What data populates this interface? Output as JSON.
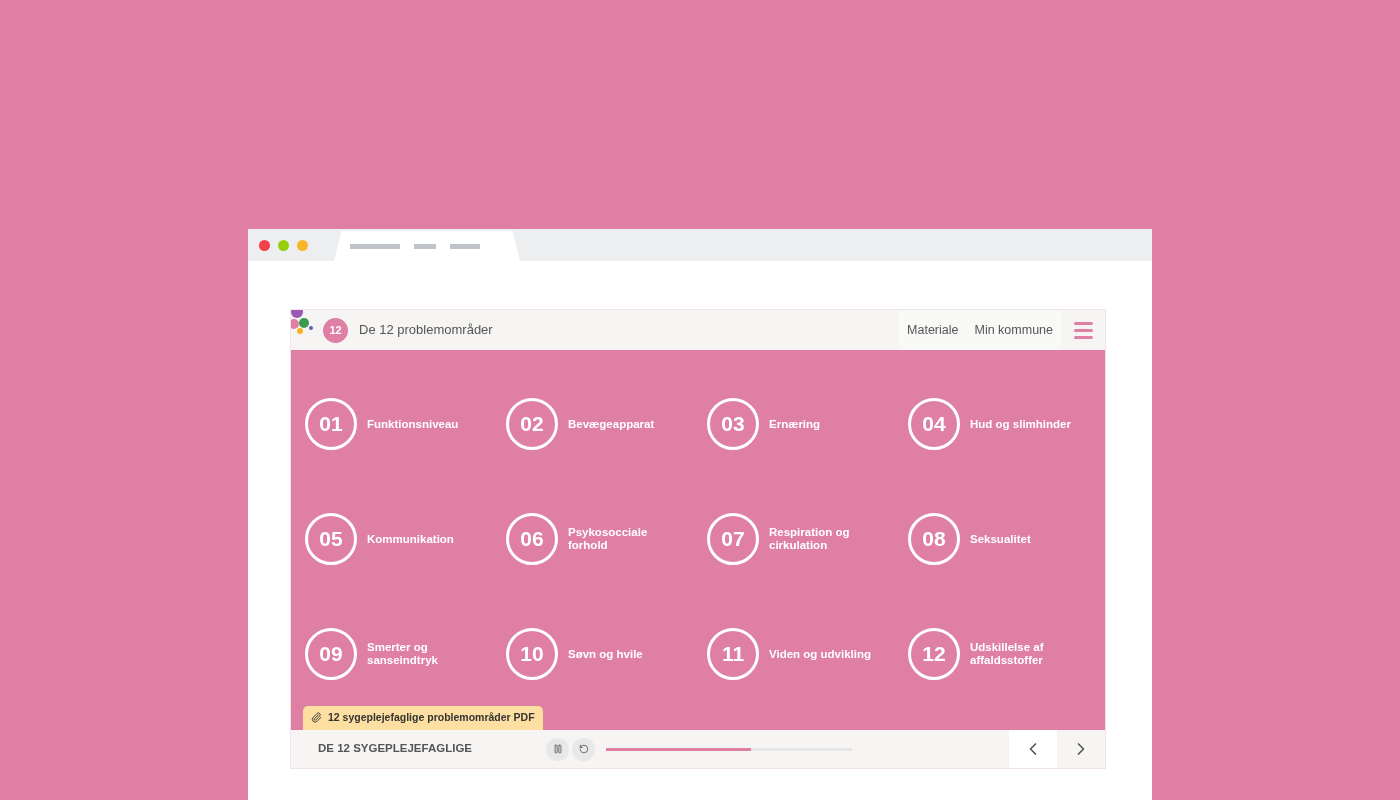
{
  "header": {
    "badge": "12",
    "title": "De 12 problemområder",
    "nav": [
      "Materiale",
      "Min kommune"
    ]
  },
  "topics": [
    {
      "number": "01",
      "label": "Funktionsniveau"
    },
    {
      "number": "02",
      "label": "Bevægeapparat"
    },
    {
      "number": "03",
      "label": "Ernæring"
    },
    {
      "number": "04",
      "label": "Hud og slimhinder"
    },
    {
      "number": "05",
      "label": "Kommunikation"
    },
    {
      "number": "06",
      "label": "Psykosocciale forhold"
    },
    {
      "number": "07",
      "label": "Respiration og cirkulation"
    },
    {
      "number": "08",
      "label": "Seksualitet"
    },
    {
      "number": "09",
      "label": "Smerter og sanseindtryk"
    },
    {
      "number": "10",
      "label": "Søvn og hvile"
    },
    {
      "number": "11",
      "label": "Viden og udvikling"
    },
    {
      "number": "12",
      "label": "Udskillelse af affaldsstoffer"
    }
  ],
  "attachment": {
    "label": "12 sygeplejefaglige problemområder PDF"
  },
  "player": {
    "title": "DE 12 SYGEPLEJEFAGLIGE",
    "progress": {
      "level": 0.59
    }
  }
}
